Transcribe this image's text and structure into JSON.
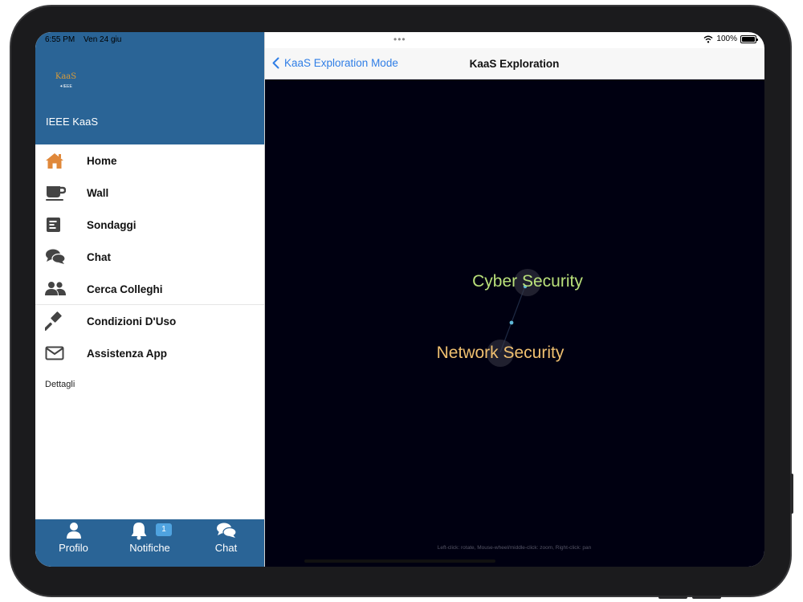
{
  "status_bar": {
    "time": "6:55 PM",
    "date": "Ven 24 giu",
    "dots": "•••",
    "battery_percent": "100%"
  },
  "sidebar": {
    "app_name": "IEEE KaaS",
    "logo_text": "KaaS",
    "logo_subtext": "✦IEEE",
    "menu_items": [
      {
        "label": "Home",
        "icon": "house-icon"
      },
      {
        "label": "Wall",
        "icon": "coffee-cup-icon"
      },
      {
        "label": "Sondaggi",
        "icon": "poll-icon"
      },
      {
        "label": "Chat",
        "icon": "chat-bubbles-icon"
      },
      {
        "label": "Cerca Colleghi",
        "icon": "users-icon"
      },
      {
        "label": "Condizioni D'Uso",
        "icon": "gavel-icon"
      },
      {
        "label": "Assistenza App",
        "icon": "envelope-icon"
      }
    ],
    "section_label": "Dettagli",
    "tabs": [
      {
        "label": "Profilo",
        "icon": "user-icon"
      },
      {
        "label": "Notifiche",
        "icon": "bell-icon",
        "badge": "1"
      },
      {
        "label": "Chat",
        "icon": "chat-bubbles-icon"
      }
    ]
  },
  "colors": {
    "brand_blue": "#2a6496",
    "home_orange": "#e0883a",
    "link_blue": "#2f7ee6",
    "graph_bg": "#000011",
    "node_cyber": "#b9e07a",
    "node_network": "#f0c070"
  },
  "navbar": {
    "back_label": "KaaS Exploration Mode",
    "title": "KaaS Exploration"
  },
  "graph": {
    "nodes": [
      {
        "label": "Cyber Security"
      },
      {
        "label": "Network Security"
      }
    ],
    "hint": "Left-click: rotate, Mouse-wheel/middle-click: zoom, Right-click: pan"
  }
}
